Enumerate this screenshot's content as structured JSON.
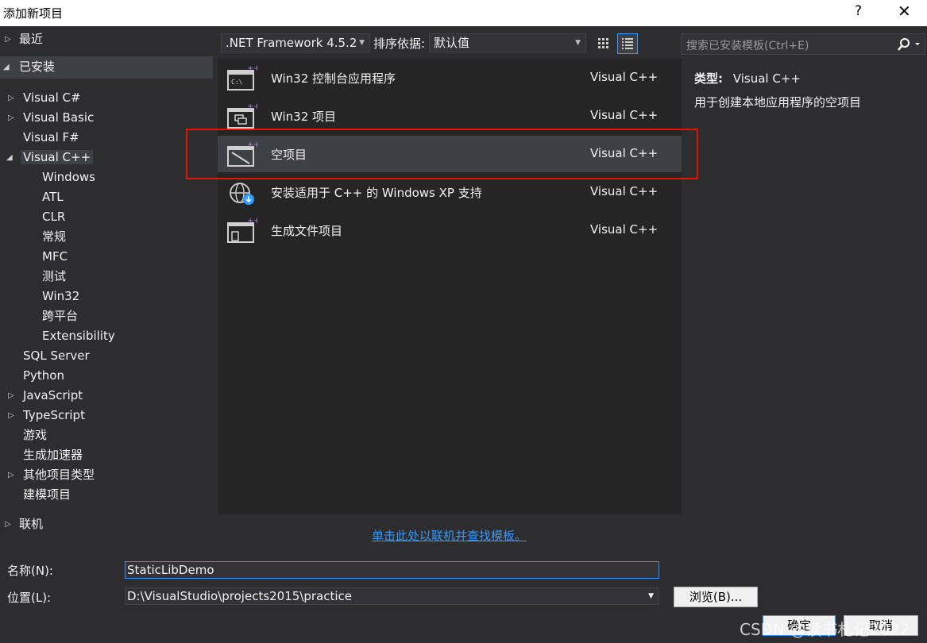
{
  "window": {
    "title": "添加新项目",
    "help": "?",
    "close": "✕"
  },
  "sidebar": {
    "recent": "最近",
    "installed": "已安装",
    "items": [
      {
        "label": "Visual C#",
        "expandable": true
      },
      {
        "label": "Visual Basic",
        "expandable": true
      },
      {
        "label": "Visual F#",
        "expandable": false
      },
      {
        "label": "Visual C++",
        "expanded": true
      },
      {
        "label": "Windows"
      },
      {
        "label": "ATL"
      },
      {
        "label": "CLR"
      },
      {
        "label": "常规"
      },
      {
        "label": "MFC"
      },
      {
        "label": "测试"
      },
      {
        "label": "Win32"
      },
      {
        "label": "跨平台"
      },
      {
        "label": "Extensibility"
      },
      {
        "label": "SQL Server"
      },
      {
        "label": "Python"
      },
      {
        "label": "JavaScript",
        "expandable": true
      },
      {
        "label": "TypeScript",
        "expandable": true
      },
      {
        "label": "游戏"
      },
      {
        "label": "生成加速器"
      },
      {
        "label": "其他项目类型",
        "expandable": true
      },
      {
        "label": "建模项目"
      }
    ],
    "online": "联机"
  },
  "toolbar": {
    "framework": ".NET Framework 4.5.2",
    "sort_label": "排序依据:",
    "sort_value": "默认值"
  },
  "search": {
    "placeholder": "搜索已安装模板(Ctrl+E)"
  },
  "templates": [
    {
      "name": "Win32 控制台应用程序",
      "lang": "Visual C++",
      "icon": "console-app-icon"
    },
    {
      "name": "Win32 项目",
      "lang": "Visual C++",
      "icon": "win32-project-icon"
    },
    {
      "name": "空项目",
      "lang": "Visual C++",
      "icon": "empty-project-icon",
      "selected": true
    },
    {
      "name": "安装适用于 C++ 的 Windows XP 支持",
      "lang": "Visual C++",
      "icon": "install-xp-support-icon"
    },
    {
      "name": "生成文件项目",
      "lang": "Visual C++",
      "icon": "makefile-project-icon"
    }
  ],
  "details": {
    "type_label": "类型:",
    "type_value": "Visual C++",
    "description": "用于创建本地应用程序的空项目"
  },
  "online_link": "单击此处以联机并查找模板。",
  "form": {
    "name_label": "名称(N):",
    "name_value": "StaticLibDemo",
    "location_label": "位置(L):",
    "location_value": "D:\\VisualStudio\\projects2015\\practice",
    "browse": "浏览(B)...",
    "ok": "确定",
    "cancel": "取消"
  },
  "watermark": "CSDN @读书札记2022",
  "colors": {
    "background": "#2d2d30",
    "list_background": "#252526",
    "selection": "#3f3f46",
    "accent": "#3399ff",
    "highlight_box": "#e51400"
  }
}
